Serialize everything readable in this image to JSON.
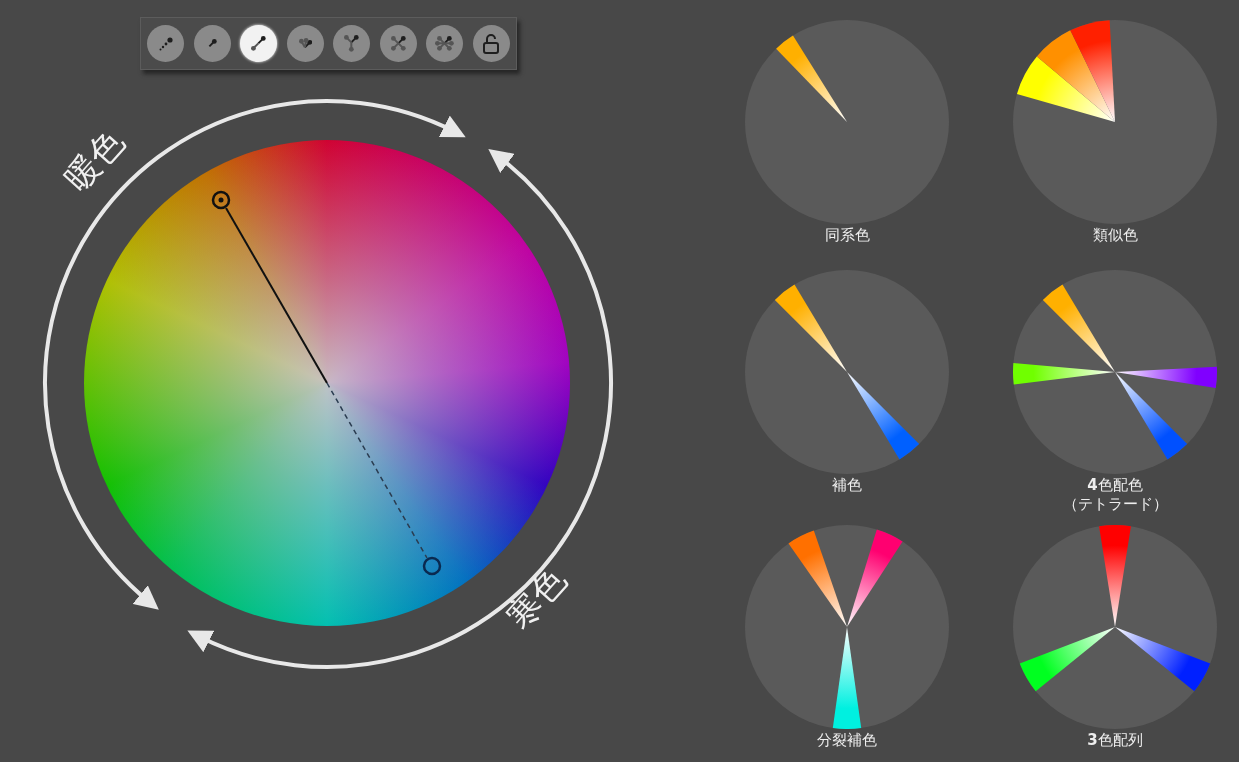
{
  "toolbar": {
    "buttons": [
      {
        "kind": "dots",
        "selected": false
      },
      {
        "kind": "single",
        "selected": false
      },
      {
        "kind": "complement",
        "selected": true
      },
      {
        "kind": "analogous",
        "selected": false
      },
      {
        "kind": "split",
        "selected": false
      },
      {
        "kind": "tetrad",
        "selected": false
      },
      {
        "kind": "hexad",
        "selected": false
      },
      {
        "kind": "lock",
        "selected": false
      }
    ]
  },
  "wheel": {
    "warm_label": "暖色",
    "cool_label": "寒色"
  },
  "schemes": [
    {
      "kind": "monochromatic",
      "label": "同系色",
      "sectors": [
        {
          "color": "#ffb000"
        }
      ]
    },
    {
      "kind": "analogous",
      "label": "類似色",
      "sectors": [
        {
          "color": "#ffff00"
        },
        {
          "color": "#ff9000"
        },
        {
          "color": "#ff2000"
        }
      ]
    },
    {
      "kind": "complementary",
      "label": "補色",
      "sectors": [
        {
          "color": "#ffb000"
        },
        {
          "color": "#0060ff"
        }
      ]
    },
    {
      "kind": "tetradic",
      "label": "**4**色配色",
      "sublabel": "（テトラード）",
      "sectors": [
        {
          "color": "#ffb000"
        },
        {
          "color": "#8000ff"
        },
        {
          "color": "#0050ff"
        },
        {
          "color": "#70ff00"
        }
      ]
    },
    {
      "kind": "split",
      "label": "分裂補色",
      "sectors": [
        {
          "color": "#ff7000"
        },
        {
          "color": "#ff0070"
        },
        {
          "color": "#00f0e0"
        }
      ]
    },
    {
      "kind": "triadic",
      "label": "**3**色配列",
      "sectors": [
        {
          "color": "#ff0000"
        },
        {
          "color": "#0020ff"
        },
        {
          "color": "#00ff20"
        }
      ]
    }
  ]
}
